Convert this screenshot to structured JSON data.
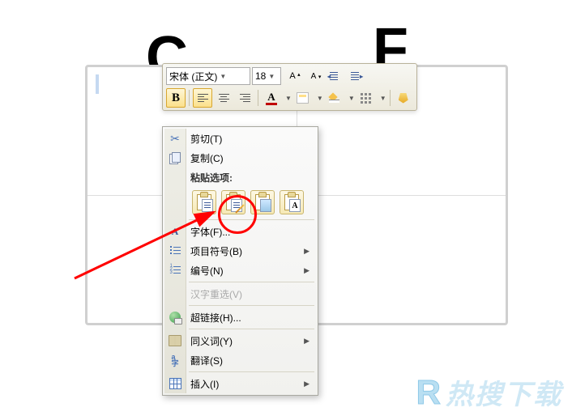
{
  "bg_letters": {
    "c": "C",
    "f": "F"
  },
  "toolbar": {
    "font_name": "宋体 (正文)",
    "font_size": "18",
    "grow_font": "A",
    "shrink_font": "A",
    "bold": "B",
    "font_color_letter": "A"
  },
  "menu": {
    "cut": "剪切(T)",
    "copy": "复制(C)",
    "paste_options_header": "粘贴选项:",
    "paste_a_label": "A",
    "font": "字体(F)...",
    "bullets": "项目符号(B)",
    "numbering": "编号(N)",
    "ime_reconvert": "汉字重选(V)",
    "hyperlink": "超链接(H)...",
    "synonyms": "同义词(Y)",
    "translate": "翻译(S)",
    "insert": "插入(I)"
  },
  "watermark": {
    "r": "R",
    "text": "热搜下载"
  }
}
